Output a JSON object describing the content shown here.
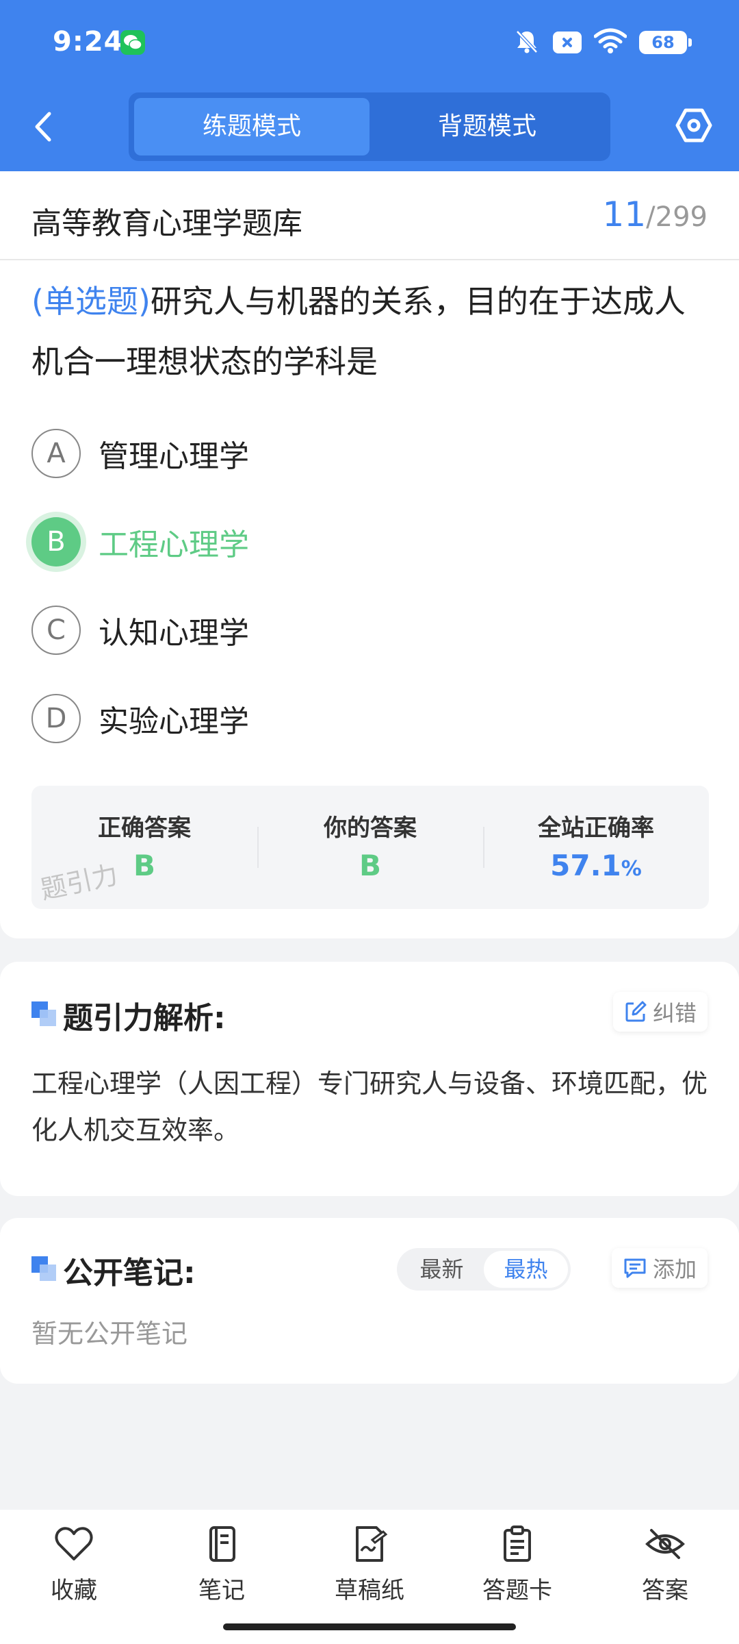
{
  "status_bar": {
    "time": "9:24",
    "battery": "68"
  },
  "header": {
    "modes": [
      "练题模式",
      "背题模式"
    ],
    "active_mode": 0
  },
  "question": {
    "bank_title": "高等教育心理学题库",
    "current": "11",
    "separator": "/",
    "total": "299",
    "type_label": "(单选题)",
    "text": "研究人与机器的关系，目的在于达成人机合一理想状态的学科是",
    "options": [
      {
        "letter": "A",
        "text": "管理心理学"
      },
      {
        "letter": "B",
        "text": "工程心理学"
      },
      {
        "letter": "C",
        "text": "认知心理学"
      },
      {
        "letter": "D",
        "text": "实验心理学"
      }
    ],
    "correct_option": "B"
  },
  "answer_summary": {
    "correct_label": "正确答案",
    "correct_value": "B",
    "yours_label": "你的答案",
    "yours_value": "B",
    "rate_label": "全站正确率",
    "rate_value": "57.1",
    "rate_unit": "%",
    "watermark": "题引力"
  },
  "analysis": {
    "title": "题引力解析:",
    "report_button": "纠错",
    "text": "工程心理学（人因工程）专门研究人与设备、环境匹配，优化人机交互效率。"
  },
  "notes": {
    "title": "公开笔记:",
    "sort_options": [
      "最新",
      "最热"
    ],
    "active_sort": 1,
    "add_button": "添加",
    "empty_text": "暂无公开笔记"
  },
  "bottom_bar": {
    "items": [
      {
        "label": "收藏",
        "icon": "heart-icon"
      },
      {
        "label": "笔记",
        "icon": "notebook-icon"
      },
      {
        "label": "草稿纸",
        "icon": "draft-paper-icon"
      },
      {
        "label": "答题卡",
        "icon": "answer-sheet-icon"
      },
      {
        "label": "答案",
        "icon": "eye-off-icon"
      }
    ]
  },
  "colors": {
    "primary": "#3f83ee",
    "correct": "#5ecb85",
    "background": "#f2f3f5"
  }
}
